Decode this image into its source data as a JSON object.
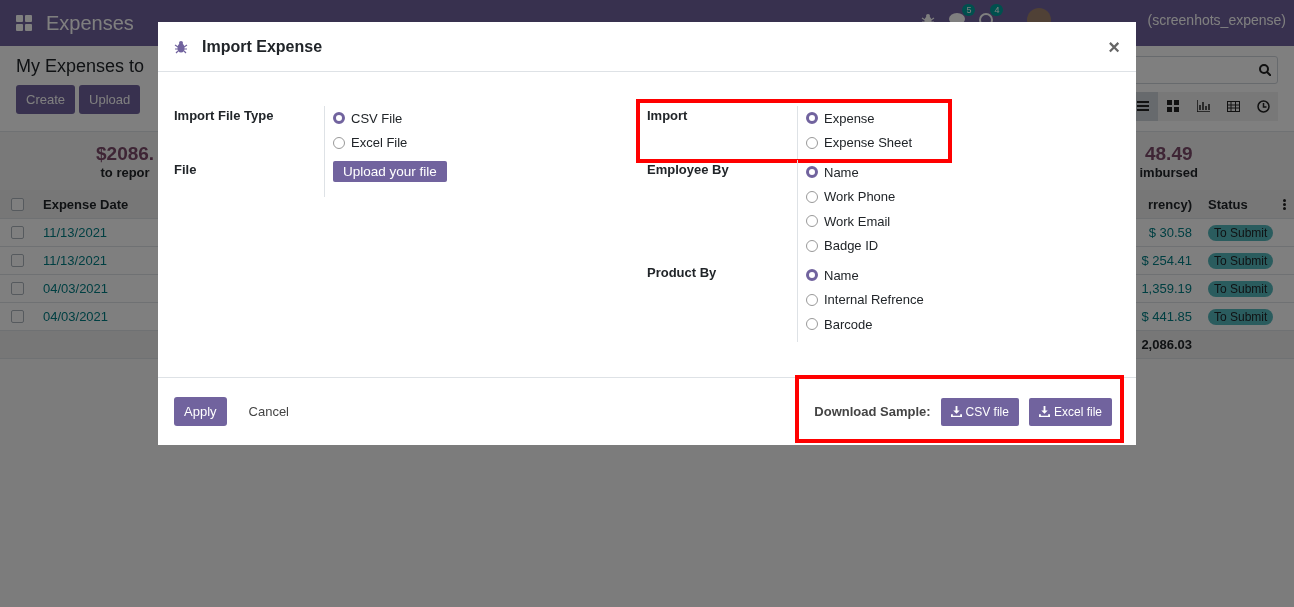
{
  "navbar": {
    "app_title": "Expenses",
    "messages_count": "5",
    "activities_count": "4",
    "user": "(screenhots_expense)"
  },
  "control_panel": {
    "breadcrumb": "My Expenses to",
    "buttons": [
      "Create",
      "Upload"
    ],
    "views": [
      {
        "kind": "list",
        "selected": true
      },
      {
        "kind": "kanban",
        "selected": false
      },
      {
        "kind": "graph",
        "selected": false
      },
      {
        "kind": "pivot",
        "selected": false
      },
      {
        "kind": "activity",
        "selected": false
      }
    ]
  },
  "summary": {
    "left_amount": "$2086.",
    "left_label": "to repor",
    "right_amount": "48.49",
    "right_label": "imbursed"
  },
  "table": {
    "select_all_checked": false,
    "column_date": "Expense Date",
    "column_amount": "rrency)",
    "column_status": "Status",
    "rows": [
      {
        "date": "11/13/2021",
        "amount": "$ 30.58",
        "status": "To Submit",
        "checked": false
      },
      {
        "date": "11/13/2021",
        "amount": "$ 254.41",
        "status": "To Submit",
        "checked": false
      },
      {
        "date": "04/03/2021",
        "amount": "1,359.19",
        "status": "To Submit",
        "checked": false
      },
      {
        "date": "04/03/2021",
        "amount": "$ 441.85",
        "status": "To Submit",
        "checked": false
      }
    ],
    "total": "2,086.03"
  },
  "dialog": {
    "title": "Import Expense",
    "close": "×",
    "left_fields": [
      {
        "label": "Import File Type",
        "kind": "radio",
        "highlighted": false,
        "options": [
          {
            "label": "CSV File",
            "selected": true
          },
          {
            "label": "Excel File",
            "selected": false
          }
        ]
      },
      {
        "label": "File",
        "kind": "upload",
        "highlighted": false,
        "button": "Upload your file"
      }
    ],
    "right_fields": [
      {
        "label": "Import",
        "kind": "radio",
        "highlighted": true,
        "options": [
          {
            "label": "Expense",
            "selected": true
          },
          {
            "label": "Expense Sheet",
            "selected": false
          }
        ]
      },
      {
        "label": "Employee By",
        "kind": "radio",
        "highlighted": false,
        "options": [
          {
            "label": "Name",
            "selected": true
          },
          {
            "label": "Work Phone",
            "selected": false
          },
          {
            "label": "Work Email",
            "selected": false
          },
          {
            "label": "Badge ID",
            "selected": false
          }
        ]
      },
      {
        "label": "Product By",
        "kind": "radio",
        "highlighted": false,
        "options": [
          {
            "label": "Name",
            "selected": true
          },
          {
            "label": "Internal Refrence",
            "selected": false
          },
          {
            "label": "Barcode",
            "selected": false
          }
        ]
      }
    ],
    "apply": "Apply",
    "cancel": "Cancel",
    "download": {
      "label": "Download Sample:",
      "highlighted": true,
      "buttons": [
        "CSV file",
        "Excel file"
      ]
    }
  }
}
